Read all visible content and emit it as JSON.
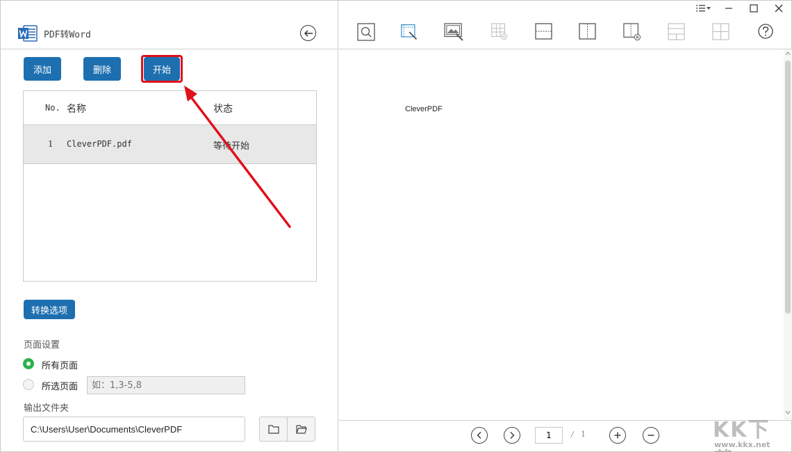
{
  "app": {
    "title": "PDF转Word"
  },
  "left": {
    "buttons": {
      "add": "添加",
      "delete": "删除",
      "start": "开始"
    },
    "table": {
      "headers": {
        "no": "No.",
        "name": "名称",
        "status": "状态"
      },
      "rows": [
        {
          "no": "1",
          "name": "CleverPDF.pdf",
          "status": "等待开始"
        }
      ]
    },
    "options_button": "转换选项",
    "page_settings": {
      "label": "页面设置",
      "all_pages": "所有页面",
      "selected_pages": "所选页面",
      "range_placeholder": "如：1,3-5,8",
      "selected": "all_pages"
    },
    "output": {
      "label": "输出文件夹",
      "path": "C:\\Users\\User\\Documents\\CleverPDF"
    }
  },
  "right": {
    "preview_text": "CleverPDF",
    "pagination": {
      "current": "1",
      "separator": "/",
      "total": "1"
    }
  },
  "watermark": {
    "logo": "KK下载",
    "url": "www.kkx.net"
  },
  "colors": {
    "accent_button": "#1d6fb0",
    "highlight": "#e0101a",
    "radio_checked": "#2cb24a"
  }
}
